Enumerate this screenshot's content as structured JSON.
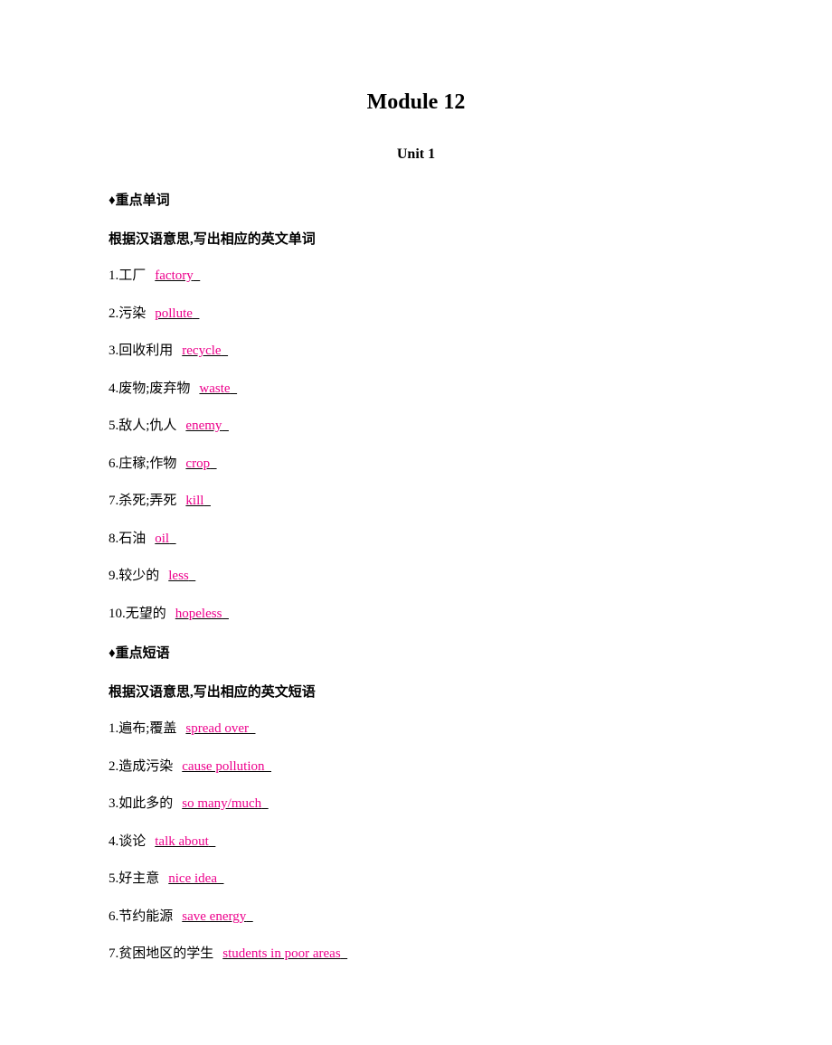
{
  "module_title": "Module 12",
  "unit_title": "Unit 1",
  "diamond": "♦",
  "section1": {
    "header": "重点单词",
    "instruction": "根据汉语意思,写出相应的英文单词",
    "items": [
      {
        "num": "1.",
        "prompt": "工厂",
        "answer": "factory"
      },
      {
        "num": "2.",
        "prompt": "污染",
        "answer": "pollute"
      },
      {
        "num": "3.",
        "prompt": "回收利用",
        "answer": "recycle"
      },
      {
        "num": "4.",
        "prompt": "废物;废弃物",
        "answer": "waste"
      },
      {
        "num": "5.",
        "prompt": "敌人;仇人",
        "answer": "enemy"
      },
      {
        "num": "6.",
        "prompt": "庄稼;作物",
        "answer": "crop"
      },
      {
        "num": "7.",
        "prompt": "杀死;弄死",
        "answer": "kill"
      },
      {
        "num": "8.",
        "prompt": "石油",
        "answer": "oil"
      },
      {
        "num": "9.",
        "prompt": "较少的",
        "answer": "less"
      },
      {
        "num": "10.",
        "prompt": "无望的",
        "answer": "hopeless"
      }
    ]
  },
  "section2": {
    "header": "重点短语",
    "instruction": "根据汉语意思,写出相应的英文短语",
    "items": [
      {
        "num": "1.",
        "prompt": "遍布;覆盖",
        "answer": "spread over"
      },
      {
        "num": "2.",
        "prompt": "造成污染",
        "answer": "cause pollution"
      },
      {
        "num": "3.",
        "prompt": "如此多的",
        "answer": "so many/much"
      },
      {
        "num": "4.",
        "prompt": "谈论",
        "answer": "talk about"
      },
      {
        "num": "5.",
        "prompt": "好主意",
        "answer": "nice idea"
      },
      {
        "num": "6.",
        "prompt": "节约能源",
        "answer": "save energy"
      },
      {
        "num": "7.",
        "prompt": "贫困地区的学生",
        "answer": "students in poor areas"
      }
    ]
  }
}
